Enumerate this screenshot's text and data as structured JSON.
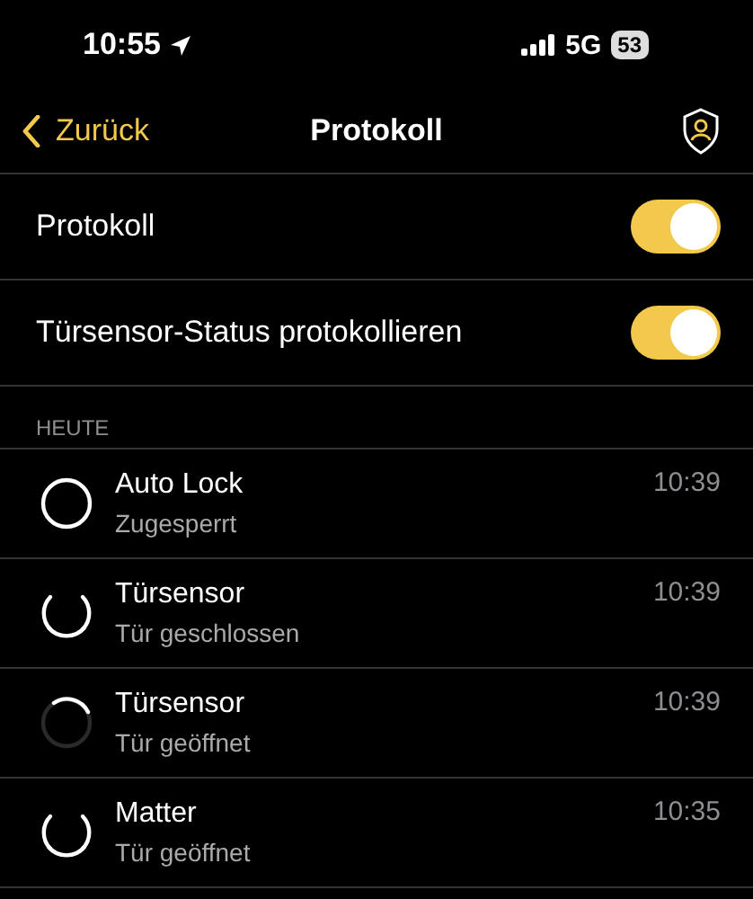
{
  "status_bar": {
    "time": "10:55",
    "network": "5G",
    "battery": "53"
  },
  "nav": {
    "back": "Zurück",
    "title": "Protokoll"
  },
  "settings": [
    {
      "label": "Protokoll",
      "on": true
    },
    {
      "label": "Türsensor-Status protokollieren",
      "on": true
    }
  ],
  "section": "HEUTE",
  "entries": [
    {
      "kind": "locked",
      "title": "Auto Lock",
      "subtitle": "Zugesperrt",
      "time": "10:39"
    },
    {
      "kind": "closed",
      "title": "Türsensor",
      "subtitle": "Tür geschlossen",
      "time": "10:39"
    },
    {
      "kind": "open",
      "title": "Türsensor",
      "subtitle": "Tür geöffnet",
      "time": "10:39"
    },
    {
      "kind": "closed",
      "title": "Matter",
      "subtitle": "Tür geöffnet",
      "time": "10:35"
    }
  ]
}
